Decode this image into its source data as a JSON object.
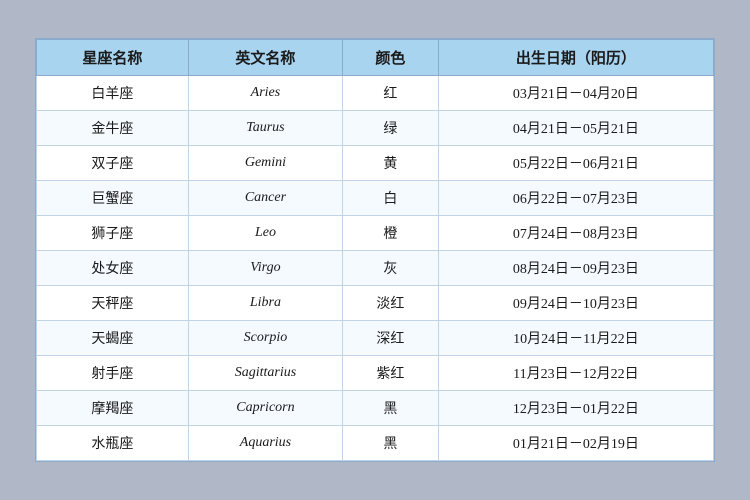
{
  "table": {
    "headers": [
      "星座名称",
      "英文名称",
      "颜色",
      "出生日期（阳历）"
    ],
    "rows": [
      {
        "zh": "白羊座",
        "en": "Aries",
        "color": "红",
        "dates": "03月21日－04月20日"
      },
      {
        "zh": "金牛座",
        "en": "Taurus",
        "color": "绿",
        "dates": "04月21日－05月21日"
      },
      {
        "zh": "双子座",
        "en": "Gemini",
        "color": "黄",
        "dates": "05月22日－06月21日"
      },
      {
        "zh": "巨蟹座",
        "en": "Cancer",
        "color": "白",
        "dates": "06月22日－07月23日"
      },
      {
        "zh": "狮子座",
        "en": "Leo",
        "color": "橙",
        "dates": "07月24日－08月23日"
      },
      {
        "zh": "处女座",
        "en": "Virgo",
        "color": "灰",
        "dates": "08月24日－09月23日"
      },
      {
        "zh": "天秤座",
        "en": "Libra",
        "color": "淡红",
        "dates": "09月24日－10月23日"
      },
      {
        "zh": "天蝎座",
        "en": "Scorpio",
        "color": "深红",
        "dates": "10月24日－11月22日"
      },
      {
        "zh": "射手座",
        "en": "Sagittarius",
        "color": "紫红",
        "dates": "11月23日－12月22日"
      },
      {
        "zh": "摩羯座",
        "en": "Capricorn",
        "color": "黑",
        "dates": "12月23日－01月22日"
      },
      {
        "zh": "水瓶座",
        "en": "Aquarius",
        "color": "黑",
        "dates": "01月21日－02月19日"
      }
    ]
  }
}
